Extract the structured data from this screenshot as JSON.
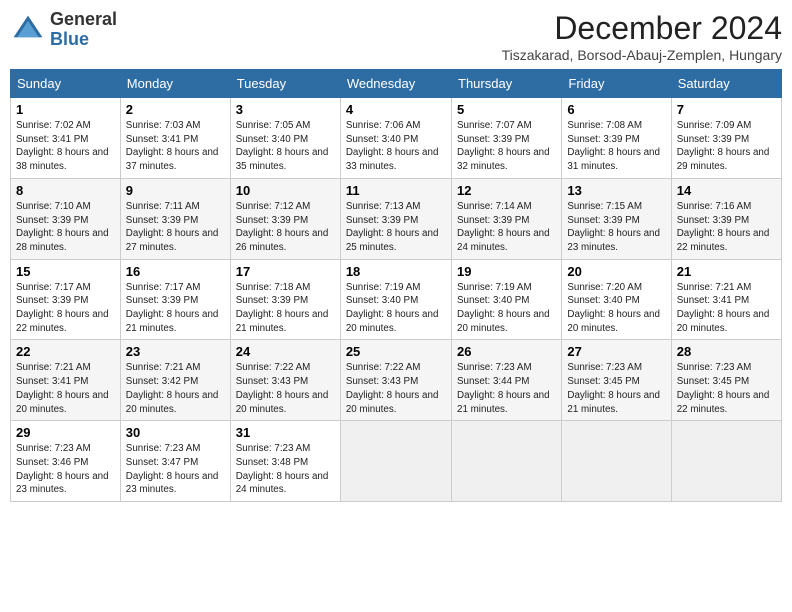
{
  "header": {
    "logo_general": "General",
    "logo_blue": "Blue",
    "title": "December 2024",
    "location": "Tiszakarad, Borsod-Abauj-Zemplen, Hungary"
  },
  "weekdays": [
    "Sunday",
    "Monday",
    "Tuesday",
    "Wednesday",
    "Thursday",
    "Friday",
    "Saturday"
  ],
  "weeks": [
    [
      {
        "day": "1",
        "sunrise": "7:02 AM",
        "sunset": "3:41 PM",
        "daylight": "8 hours and 38 minutes."
      },
      {
        "day": "2",
        "sunrise": "7:03 AM",
        "sunset": "3:41 PM",
        "daylight": "8 hours and 37 minutes."
      },
      {
        "day": "3",
        "sunrise": "7:05 AM",
        "sunset": "3:40 PM",
        "daylight": "8 hours and 35 minutes."
      },
      {
        "day": "4",
        "sunrise": "7:06 AM",
        "sunset": "3:40 PM",
        "daylight": "8 hours and 33 minutes."
      },
      {
        "day": "5",
        "sunrise": "7:07 AM",
        "sunset": "3:39 PM",
        "daylight": "8 hours and 32 minutes."
      },
      {
        "day": "6",
        "sunrise": "7:08 AM",
        "sunset": "3:39 PM",
        "daylight": "8 hours and 31 minutes."
      },
      {
        "day": "7",
        "sunrise": "7:09 AM",
        "sunset": "3:39 PM",
        "daylight": "8 hours and 29 minutes."
      }
    ],
    [
      {
        "day": "8",
        "sunrise": "7:10 AM",
        "sunset": "3:39 PM",
        "daylight": "8 hours and 28 minutes."
      },
      {
        "day": "9",
        "sunrise": "7:11 AM",
        "sunset": "3:39 PM",
        "daylight": "8 hours and 27 minutes."
      },
      {
        "day": "10",
        "sunrise": "7:12 AM",
        "sunset": "3:39 PM",
        "daylight": "8 hours and 26 minutes."
      },
      {
        "day": "11",
        "sunrise": "7:13 AM",
        "sunset": "3:39 PM",
        "daylight": "8 hours and 25 minutes."
      },
      {
        "day": "12",
        "sunrise": "7:14 AM",
        "sunset": "3:39 PM",
        "daylight": "8 hours and 24 minutes."
      },
      {
        "day": "13",
        "sunrise": "7:15 AM",
        "sunset": "3:39 PM",
        "daylight": "8 hours and 23 minutes."
      },
      {
        "day": "14",
        "sunrise": "7:16 AM",
        "sunset": "3:39 PM",
        "daylight": "8 hours and 22 minutes."
      }
    ],
    [
      {
        "day": "15",
        "sunrise": "7:17 AM",
        "sunset": "3:39 PM",
        "daylight": "8 hours and 22 minutes."
      },
      {
        "day": "16",
        "sunrise": "7:17 AM",
        "sunset": "3:39 PM",
        "daylight": "8 hours and 21 minutes."
      },
      {
        "day": "17",
        "sunrise": "7:18 AM",
        "sunset": "3:39 PM",
        "daylight": "8 hours and 21 minutes."
      },
      {
        "day": "18",
        "sunrise": "7:19 AM",
        "sunset": "3:40 PM",
        "daylight": "8 hours and 20 minutes."
      },
      {
        "day": "19",
        "sunrise": "7:19 AM",
        "sunset": "3:40 PM",
        "daylight": "8 hours and 20 minutes."
      },
      {
        "day": "20",
        "sunrise": "7:20 AM",
        "sunset": "3:40 PM",
        "daylight": "8 hours and 20 minutes."
      },
      {
        "day": "21",
        "sunrise": "7:21 AM",
        "sunset": "3:41 PM",
        "daylight": "8 hours and 20 minutes."
      }
    ],
    [
      {
        "day": "22",
        "sunrise": "7:21 AM",
        "sunset": "3:41 PM",
        "daylight": "8 hours and 20 minutes."
      },
      {
        "day": "23",
        "sunrise": "7:21 AM",
        "sunset": "3:42 PM",
        "daylight": "8 hours and 20 minutes."
      },
      {
        "day": "24",
        "sunrise": "7:22 AM",
        "sunset": "3:43 PM",
        "daylight": "8 hours and 20 minutes."
      },
      {
        "day": "25",
        "sunrise": "7:22 AM",
        "sunset": "3:43 PM",
        "daylight": "8 hours and 20 minutes."
      },
      {
        "day": "26",
        "sunrise": "7:23 AM",
        "sunset": "3:44 PM",
        "daylight": "8 hours and 21 minutes."
      },
      {
        "day": "27",
        "sunrise": "7:23 AM",
        "sunset": "3:45 PM",
        "daylight": "8 hours and 21 minutes."
      },
      {
        "day": "28",
        "sunrise": "7:23 AM",
        "sunset": "3:45 PM",
        "daylight": "8 hours and 22 minutes."
      }
    ],
    [
      {
        "day": "29",
        "sunrise": "7:23 AM",
        "sunset": "3:46 PM",
        "daylight": "8 hours and 23 minutes."
      },
      {
        "day": "30",
        "sunrise": "7:23 AM",
        "sunset": "3:47 PM",
        "daylight": "8 hours and 23 minutes."
      },
      {
        "day": "31",
        "sunrise": "7:23 AM",
        "sunset": "3:48 PM",
        "daylight": "8 hours and 24 minutes."
      },
      null,
      null,
      null,
      null
    ]
  ],
  "labels": {
    "sunrise": "Sunrise:",
    "sunset": "Sunset:",
    "daylight": "Daylight:"
  }
}
